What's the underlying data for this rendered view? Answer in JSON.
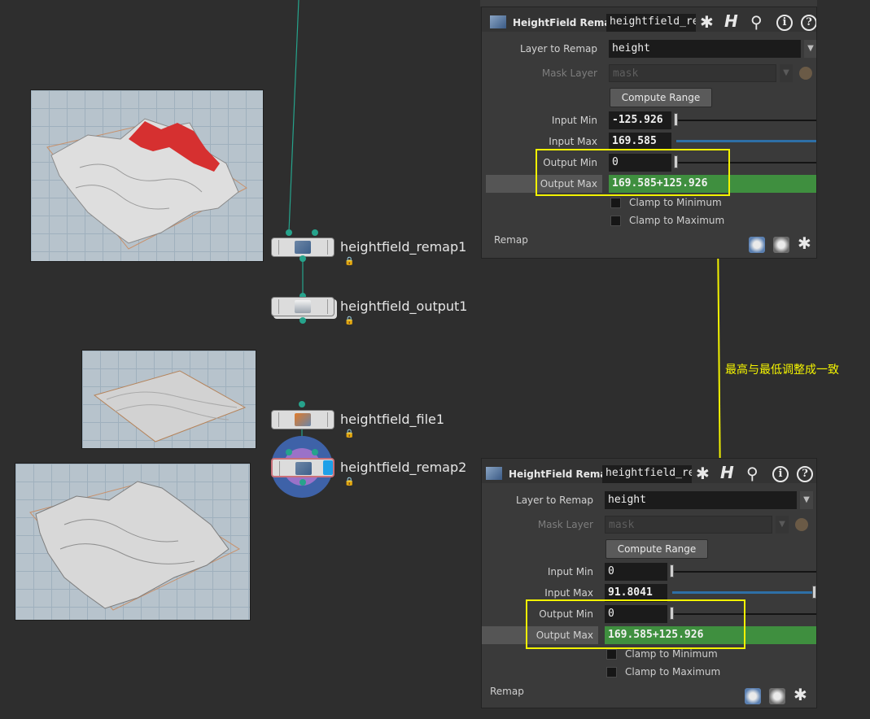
{
  "nodes": [
    {
      "label": "heightfield_remap1"
    },
    {
      "label": "heightfield_output1"
    },
    {
      "label": "heightfield_file1"
    },
    {
      "label": "heightfield_remap2"
    }
  ],
  "panel_top": {
    "type_label": "HeightField Remap",
    "node_name": "heightfield_re",
    "layer_to_remap_label": "Layer to Remap",
    "layer_to_remap_value": "height",
    "mask_layer_label": "Mask Layer",
    "mask_layer_placeholder": "mask",
    "compute_range_label": "Compute Range",
    "input_min_label": "Input Min",
    "input_min_value": "-125.926",
    "input_max_label": "Input Max",
    "input_max_value": "169.585",
    "output_min_label": "Output Min",
    "output_min_value": "0",
    "output_max_label": "Output Max",
    "output_max_value": "169.585+125.926",
    "clamp_min_label": "Clamp to Minimum",
    "clamp_max_label": "Clamp to Maximum",
    "footer_label": "Remap"
  },
  "panel_bottom": {
    "type_label": "HeightField Remap",
    "node_name": "heightfield_re",
    "layer_to_remap_label": "Layer to Remap",
    "layer_to_remap_value": "height",
    "mask_layer_label": "Mask Layer",
    "mask_layer_placeholder": "mask",
    "compute_range_label": "Compute Range",
    "input_min_label": "Input Min",
    "input_min_value": "0",
    "input_max_label": "Input Max",
    "input_max_value": "91.8041",
    "output_min_label": "Output Min",
    "output_min_value": "0",
    "output_max_label": "Output Max",
    "output_max_value": "169.585+125.926",
    "clamp_min_label": "Clamp to Minimum",
    "clamp_max_label": "Clamp to Maximum",
    "footer_label": "Remap"
  },
  "annotation": "最高与最低调整成一致",
  "colors": {
    "accent_yellow": "#f2f200",
    "wire_teal": "#26a38c",
    "expr_green": "#3f8f3f"
  }
}
